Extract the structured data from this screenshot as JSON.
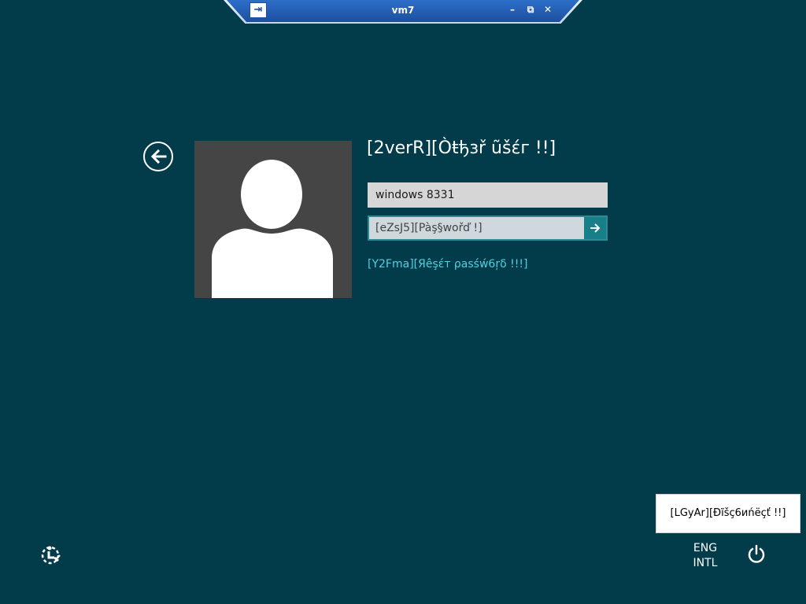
{
  "rdp_bar": {
    "pin_glyph": "⇥",
    "title": "vm7",
    "minimize_glyph": "–",
    "restore_glyph": "⧉",
    "close_glyph": "✕"
  },
  "login": {
    "user_title": "[2verR][Òŧђзř ũšέг !!]",
    "username_value": "windows 8331",
    "password_placeholder": "[eZsJ5][Pàş§wořď !]",
    "reset_link": "[Y2Fma][Яêşέт ρasśẃ6ŗδ !!!]"
  },
  "tooltip": {
    "disconnect": "[LGyAr][Đĩšç6иńёçť !!]"
  },
  "taskbar": {
    "lang_line1": "ENG",
    "lang_line2": "INTL"
  },
  "icons": {
    "back": "back-arrow-icon",
    "submit": "arrow-right-icon",
    "power": "power-icon",
    "ease_of_access": "ease-of-access-icon"
  },
  "colors": {
    "background": "#023c4b",
    "accent": "#187e88",
    "link": "#4fd1e0"
  }
}
